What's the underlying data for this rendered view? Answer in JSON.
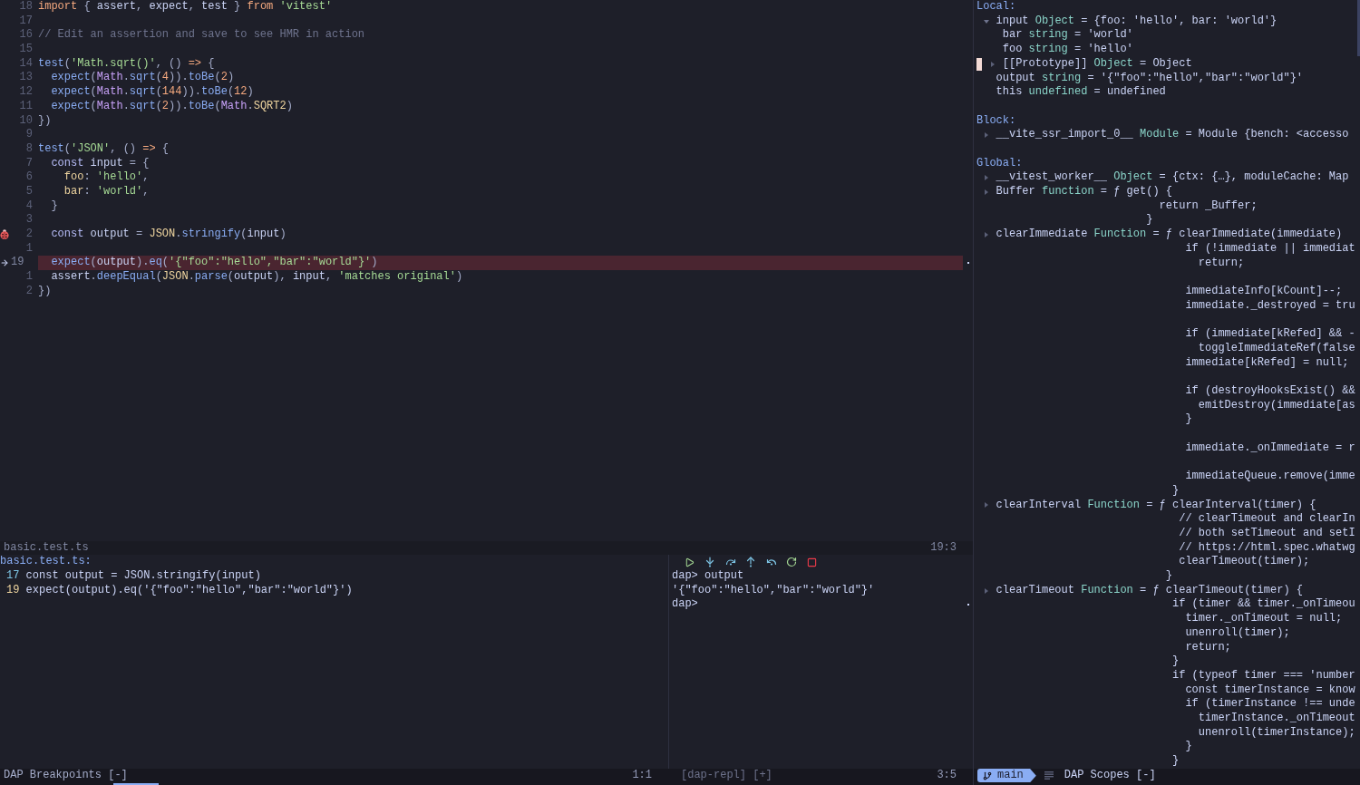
{
  "editor": {
    "lines": [
      {
        "number": "18",
        "current": false,
        "breakpoint": false,
        "tokens": [
          {
            "text": "import",
            "kind": "keyword"
          },
          {
            "text": " { ",
            "kind": "punct"
          },
          {
            "text": "assert",
            "kind": "plain"
          },
          {
            "text": ", ",
            "kind": "punct"
          },
          {
            "text": "expect",
            "kind": "plain"
          },
          {
            "text": ", ",
            "kind": "punct"
          },
          {
            "text": "test",
            "kind": "plain"
          },
          {
            "text": " } ",
            "kind": "punct"
          },
          {
            "text": "from ",
            "kind": "keyword"
          },
          {
            "text": "'vitest'",
            "kind": "string"
          }
        ]
      },
      {
        "number": "17",
        "current": false,
        "breakpoint": false
      },
      {
        "number": "16",
        "current": false,
        "breakpoint": false,
        "tokens": [
          {
            "text": "// Edit an assertion and save to see HMR in action",
            "kind": "comment"
          }
        ]
      },
      {
        "number": "15",
        "current": false,
        "breakpoint": false
      },
      {
        "number": "14",
        "current": false,
        "breakpoint": false,
        "tokens": [
          {
            "text": "test",
            "kind": "function"
          },
          {
            "text": "(",
            "kind": "punct"
          },
          {
            "text": "'Math.sqrt()'",
            "kind": "string"
          },
          {
            "text": ", () ",
            "kind": "punct"
          },
          {
            "text": "=>",
            "kind": "operator"
          },
          {
            "text": " {",
            "kind": "punct"
          }
        ]
      },
      {
        "number": "13",
        "current": false,
        "breakpoint": false,
        "tokens": [
          {
            "text": "  expect",
            "kind": "function"
          },
          {
            "text": "(",
            "kind": "punct"
          },
          {
            "text": "Math",
            "kind": "builtin"
          },
          {
            "text": ".",
            "kind": "punct"
          },
          {
            "text": "sqrt",
            "kind": "function"
          },
          {
            "text": "(",
            "kind": "punct"
          },
          {
            "text": "4",
            "kind": "number"
          },
          {
            "text": ")).",
            "kind": "punct"
          },
          {
            "text": "toBe",
            "kind": "function"
          },
          {
            "text": "(",
            "kind": "punct"
          },
          {
            "text": "2",
            "kind": "number"
          },
          {
            "text": ")",
            "kind": "punct"
          }
        ]
      },
      {
        "number": "12",
        "current": false,
        "breakpoint": false,
        "tokens": [
          {
            "text": "  expect",
            "kind": "function"
          },
          {
            "text": "(",
            "kind": "punct"
          },
          {
            "text": "Math",
            "kind": "builtin"
          },
          {
            "text": ".",
            "kind": "punct"
          },
          {
            "text": "sqrt",
            "kind": "function"
          },
          {
            "text": "(",
            "kind": "punct"
          },
          {
            "text": "144",
            "kind": "number"
          },
          {
            "text": ")).",
            "kind": "punct"
          },
          {
            "text": "toBe",
            "kind": "function"
          },
          {
            "text": "(",
            "kind": "punct"
          },
          {
            "text": "12",
            "kind": "number"
          },
          {
            "text": ")",
            "kind": "punct"
          }
        ]
      },
      {
        "number": "11",
        "current": false,
        "breakpoint": false,
        "tokens": [
          {
            "text": "  expect",
            "kind": "function"
          },
          {
            "text": "(",
            "kind": "punct"
          },
          {
            "text": "Math",
            "kind": "builtin"
          },
          {
            "text": ".",
            "kind": "punct"
          },
          {
            "text": "sqrt",
            "kind": "function"
          },
          {
            "text": "(",
            "kind": "punct"
          },
          {
            "text": "2",
            "kind": "number"
          },
          {
            "text": ")).",
            "kind": "punct"
          },
          {
            "text": "toBe",
            "kind": "function"
          },
          {
            "text": "(",
            "kind": "punct"
          },
          {
            "text": "Math",
            "kind": "builtin"
          },
          {
            "text": ".",
            "kind": "punct"
          },
          {
            "text": "SQRT2",
            "kind": "constant"
          },
          {
            "text": ")",
            "kind": "punct"
          }
        ]
      },
      {
        "number": "10",
        "current": false,
        "breakpoint": false,
        "tokens": [
          {
            "text": "})",
            "kind": "punct"
          }
        ]
      },
      {
        "number": "9",
        "current": false,
        "breakpoint": false
      },
      {
        "number": "8",
        "current": false,
        "breakpoint": false,
        "tokens": [
          {
            "text": "test",
            "kind": "function"
          },
          {
            "text": "(",
            "kind": "punct"
          },
          {
            "text": "'JSON'",
            "kind": "string"
          },
          {
            "text": ", () ",
            "kind": "punct"
          },
          {
            "text": "=>",
            "kind": "operator"
          },
          {
            "text": " {",
            "kind": "punct"
          }
        ]
      },
      {
        "number": "7",
        "current": false,
        "breakpoint": false,
        "tokens": [
          {
            "text": "  const ",
            "kind": "storage"
          },
          {
            "text": "input",
            "kind": "plain"
          },
          {
            "text": " = {",
            "kind": "punct"
          }
        ]
      },
      {
        "number": "6",
        "current": false,
        "breakpoint": false,
        "tokens": [
          {
            "text": "    foo",
            "kind": "property"
          },
          {
            "text": ": ",
            "kind": "punct"
          },
          {
            "text": "'hello'",
            "kind": "string"
          },
          {
            "text": ",",
            "kind": "punct"
          }
        ]
      },
      {
        "number": "5",
        "current": false,
        "breakpoint": false,
        "tokens": [
          {
            "text": "    bar",
            "kind": "property"
          },
          {
            "text": ": ",
            "kind": "punct"
          },
          {
            "text": "'world'",
            "kind": "string"
          },
          {
            "text": ",",
            "kind": "punct"
          }
        ]
      },
      {
        "number": "4",
        "current": false,
        "breakpoint": false,
        "tokens": [
          {
            "text": "  }",
            "kind": "punct"
          }
        ]
      },
      {
        "number": "3",
        "current": false,
        "breakpoint": false
      },
      {
        "number": "2",
        "current": false,
        "breakpoint": true,
        "tokens": [
          {
            "text": "  const ",
            "kind": "storage"
          },
          {
            "text": "output",
            "kind": "plain"
          },
          {
            "text": " = ",
            "kind": "punct"
          },
          {
            "text": "JSON",
            "kind": "constant"
          },
          {
            "text": ".",
            "kind": "punct"
          },
          {
            "text": "stringify",
            "kind": "function"
          },
          {
            "text": "(",
            "kind": "punct"
          },
          {
            "text": "input",
            "kind": "plain"
          },
          {
            "text": ")",
            "kind": "punct"
          }
        ]
      },
      {
        "number": "1",
        "current": false,
        "breakpoint": false
      },
      {
        "number": "19",
        "current": true,
        "breakpoint": false,
        "tokens": [
          {
            "text": "  expect",
            "kind": "function"
          },
          {
            "text": "(",
            "kind": "punct"
          },
          {
            "text": "output",
            "kind": "plain"
          },
          {
            "text": ").",
            "kind": "punct"
          },
          {
            "text": "eq",
            "kind": "function"
          },
          {
            "text": "(",
            "kind": "punct"
          },
          {
            "text": "'{\"foo\":\"hello\",\"bar\":\"world\"}'",
            "kind": "string"
          },
          {
            "text": ")",
            "kind": "punct"
          }
        ]
      },
      {
        "number": "1",
        "current": false,
        "breakpoint": false,
        "tokens": [
          {
            "text": "  assert",
            "kind": "plain"
          },
          {
            "text": ".",
            "kind": "punct"
          },
          {
            "text": "deepEqual",
            "kind": "function"
          },
          {
            "text": "(",
            "kind": "punct"
          },
          {
            "text": "JSON",
            "kind": "constant"
          },
          {
            "text": ".",
            "kind": "punct"
          },
          {
            "text": "parse",
            "kind": "function"
          },
          {
            "text": "(",
            "kind": "punct"
          },
          {
            "text": "output",
            "kind": "plain"
          },
          {
            "text": "), ",
            "kind": "punct"
          },
          {
            "text": "input",
            "kind": "plain"
          },
          {
            "text": ", ",
            "kind": "punct"
          },
          {
            "text": "'matches original'",
            "kind": "string"
          },
          {
            "text": ")",
            "kind": "punct"
          }
        ]
      },
      {
        "number": "2",
        "current": false,
        "breakpoint": false,
        "tokens": [
          {
            "text": "})",
            "kind": "punct"
          }
        ]
      }
    ],
    "status": {
      "file": "basic.test.ts",
      "position": "19:3"
    }
  },
  "breakpoints": {
    "file": "basic.test.ts:",
    "entries": [
      {
        "line": "17",
        "code": "const output = JSON.stringify(input)",
        "current": false
      },
      {
        "line": "19",
        "code": "expect(output).eq('{\"foo\":\"hello\",\"bar\":\"world\"}')",
        "current": true
      }
    ],
    "status": {
      "title": "DAP Breakpoints [-]",
      "position": "1:1"
    }
  },
  "repl": {
    "lines": [
      "dap> output",
      "'{\"foo\":\"hello\",\"bar\":\"world\"}'"
    ],
    "prompt": "dap>",
    "status": {
      "title": "[dap-repl] [+]",
      "position": "3:5"
    }
  },
  "scopes": {
    "sections": [
      {
        "title": "Local:",
        "variables": [
          {
            "kind": "group",
            "expanded": true,
            "name": "input",
            "type": "Object",
            "value": "= {foo: 'hello', bar: 'world'}",
            "children": [
              {
                "kind": "leaf",
                "cursor": false,
                "name": "bar",
                "type": "string",
                "value": "= 'world'"
              },
              {
                "kind": "leaf",
                "cursor": false,
                "name": "foo",
                "type": "string",
                "value": "= 'hello'"
              },
              {
                "kind": "group",
                "expanded": false,
                "cursor": true,
                "name": "[[Prototype]]",
                "type": "Object",
                "value": "= Object"
              }
            ]
          },
          {
            "kind": "leaf",
            "name": "output",
            "type": "string",
            "value": "= '{\"foo\":\"hello\",\"bar\":\"world\"}'"
          },
          {
            "kind": "leaf",
            "name": "this",
            "type": "undefined",
            "value": "= undefined"
          }
        ]
      },
      {
        "title": "Block:",
        "variables": [
          {
            "kind": "group",
            "expanded": false,
            "name": "__vite_ssr_import_0__",
            "type": "Module",
            "value": "= Module {bench: <accesso"
          }
        ]
      },
      {
        "title": "Global:",
        "variables": [
          {
            "kind": "group",
            "expanded": false,
            "name": "__vitest_worker__",
            "type": "Object",
            "value": "= {ctx: {…}, moduleCache: Map"
          },
          {
            "kind": "group",
            "expanded": false,
            "name": "Buffer",
            "type": "function",
            "value": "= ƒ get() {\n         return _Buffer;\n       }"
          },
          {
            "kind": "group",
            "expanded": false,
            "name": "clearImmediate",
            "type": "Function",
            "value": "= ƒ clearImmediate(immediate)\n     if (!immediate || immediat\n       return;\n\n     immediateInfo[kCount]--;\n     immediate._destroyed = tru\n\n     if (immediate[kRefed] && -\n       toggleImmediateRef(false\n     immediate[kRefed] = null;\n\n     if (destroyHooksExist() &&\n       emitDestroy(immediate[as\n     }\n\n     immediate._onImmediate = r\n\n     immediateQueue.remove(imme\n   }"
          },
          {
            "kind": "group",
            "expanded": false,
            "name": "clearInterval",
            "type": "Function",
            "value": "= ƒ clearInterval(timer) {\n     // clearTimeout and clearIn\n     // both setTimeout and setI\n     // https://html.spec.whatwg\n     clearTimeout(timer);\n   }"
          },
          {
            "kind": "group",
            "expanded": false,
            "name": "clearTimeout",
            "type": "Function",
            "value": "= ƒ clearTimeout(timer) {\n     if (timer && timer._onTimeou\n       timer._onTimeout = null;\n       unenroll(timer);\n       return;\n     }\n     if (typeof timer === 'number\n       const timerInstance = know\n       if (timerInstance !== unde\n         timerInstance._onTimeout\n         unenroll(timerInstance);\n       }\n     }"
          }
        ]
      }
    ],
    "status": {
      "branch": "main",
      "title": "DAP Scopes [-]"
    }
  }
}
